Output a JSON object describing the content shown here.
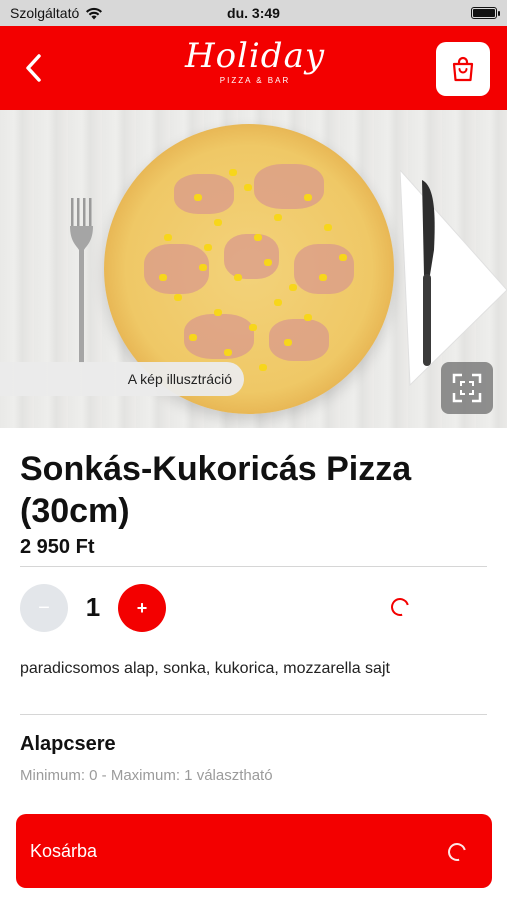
{
  "status_bar": {
    "carrier": "Szolgáltató",
    "time": "du. 3:49"
  },
  "header": {
    "brand_name": "Holiday",
    "brand_sub": "PIZZA & BAR",
    "back_icon": "chevron-left-icon",
    "cart_icon": "shopping-bag-icon",
    "background_color": "#f30000"
  },
  "hero": {
    "illustration_note": "A kép illusztráció",
    "expand_icon": "expand-icon"
  },
  "product": {
    "title": "Sonkás-Kukoricás Pizza (30cm)",
    "price": "2 950 Ft",
    "quantity": "1",
    "minus_label": "−",
    "plus_label": "+",
    "description": "paradicsomos alap, sonka, kukorica, mozzarella sajt"
  },
  "option_group": {
    "title": "Alapcsere",
    "constraint": "Minimum: 0 - Maximum: 1 választható"
  },
  "footer": {
    "add_to_cart_label": "Kosárba"
  },
  "colors": {
    "accent": "#f30000",
    "minus_disabled": "#e3e6ea"
  }
}
